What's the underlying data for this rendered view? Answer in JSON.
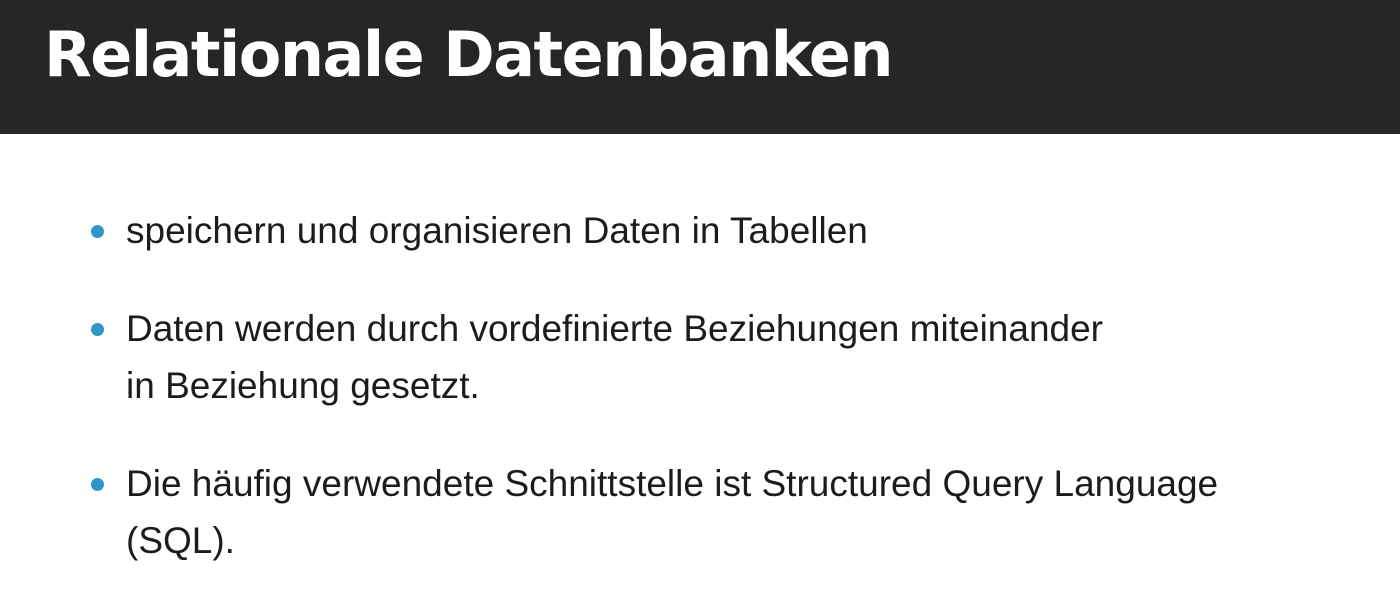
{
  "slide": {
    "title": "Relationale Datenbanken",
    "bullets": [
      {
        "lines": [
          "speichern und organisieren Daten in Tabellen"
        ]
      },
      {
        "lines": [
          "Daten werden durch vordefinierte Beziehungen miteinander",
          "in Beziehung gesetzt."
        ]
      },
      {
        "lines": [
          "Die häufig verwendete Schnittstelle ist Structured Query Language",
          "(SQL)."
        ]
      }
    ]
  },
  "colors": {
    "title_bar": "#262626",
    "title_text": "#ffffff",
    "bullet_dot": "#2e96c8",
    "body_text": "#1c1c1c",
    "background": "#ffffff"
  },
  "icons": {
    "bullet_marker": "bullet-dot-icon"
  }
}
